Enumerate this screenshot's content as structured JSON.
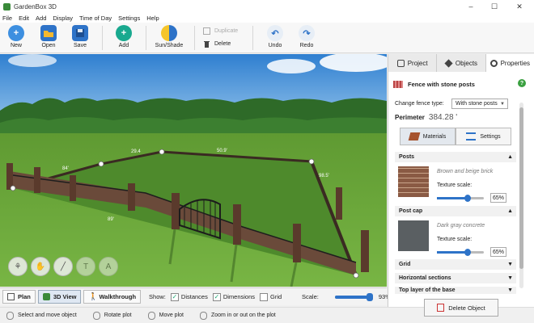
{
  "window": {
    "title": "GardenBox 3D",
    "controls": [
      "–",
      "☐",
      "✕"
    ]
  },
  "menu": [
    "File",
    "Edit",
    "Add",
    "Display",
    "Time of Day",
    "Settings",
    "Help"
  ],
  "toolbar": {
    "new": "New",
    "open": "Open",
    "save": "Save",
    "add": "Add",
    "sun_shade": "Sun/Shade",
    "duplicate": "Duplicate",
    "delete": "Delete",
    "undo": "Undo",
    "redo": "Redo"
  },
  "viewport": {
    "labels": [
      "29.4",
      "98.5'",
      "50.9'",
      "84'",
      "89'"
    ]
  },
  "view_bar": {
    "plan": "Plan",
    "view3d": "3D View",
    "walkthrough": "Walkthrough",
    "show_label": "Show:",
    "distances": "Distances",
    "dimensions": "Dimensions",
    "grid": "Grid",
    "scale_label": "Scale:",
    "scale_value": "93%",
    "scale_fraction": 0.93
  },
  "status": {
    "items": [
      "Select and move object",
      "Rotate plot",
      "Move plot",
      "Zoom in or out on the plot"
    ]
  },
  "panel": {
    "tabs": [
      "Project",
      "Objects",
      "Properties"
    ],
    "object_title": "Fence with stone posts",
    "change_type_label": "Change fence type:",
    "change_type_value": "With stone posts",
    "perimeter_label": "Perimeter",
    "perimeter_value": "384.28 '",
    "subtabs": [
      "Materials",
      "Settings"
    ],
    "posts": {
      "header": "Posts",
      "material": "Brown and beige brick",
      "texture_label": "Texture scale:",
      "texture_value": "65%",
      "texture_fraction": 0.65
    },
    "post_cap": {
      "header": "Post cap",
      "material": "Dark gray concrete",
      "texture_label": "Texture scale:",
      "texture_value": "65%",
      "texture_fraction": 0.65
    },
    "collapsed_sections": [
      "Grid",
      "Horizontal sections",
      "Top layer of the base"
    ],
    "delete_button": "Delete Object"
  },
  "colors": {
    "accent": "#2e73c8",
    "help_green": "#3aa040",
    "grass": "#6aa53a",
    "sky": "#4a98d8"
  }
}
